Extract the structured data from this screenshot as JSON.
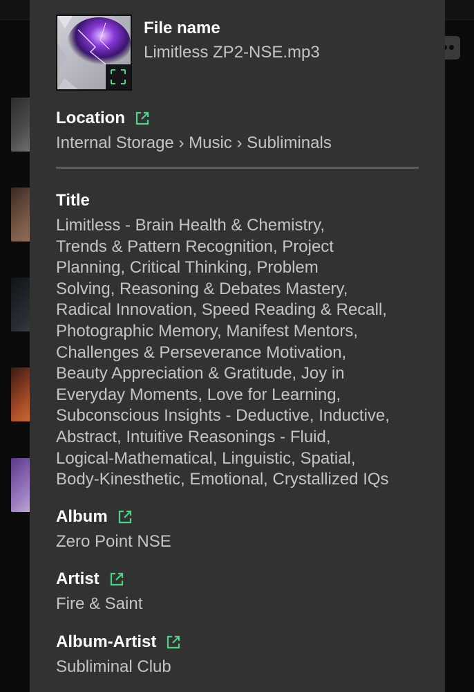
{
  "details": {
    "file_name_label": "File name",
    "file_name": "Limitless ZP2-NSE.mp3",
    "location_label": "Location",
    "location": "Internal Storage › Music › Subliminals",
    "title_label": "Title",
    "title_lines": [
      "Limitless - Brain Health & Chemistry,",
      "Trends & Pattern Recognition, Project",
      "Planning, Critical Thinking, Problem",
      "Solving, Reasoning & Debates Mastery,",
      "Radical Innovation, Speed Reading & Recall,",
      "Photographic Memory, Manifest Mentors,",
      "Challenges & Perseverance Motivation,",
      "Beauty Appreciation & Gratitude, Joy in",
      "Everyday Moments, Love for Learning,",
      "Subconscious Insights - Deductive, Inductive,",
      "Abstract, Intuitive Reasonings - Fluid,",
      "Logical-Mathematical, Linguistic, Spatial,",
      "Body-Kinesthetic, Emotional, Crystallized IQs"
    ],
    "album_label": "Album",
    "album": "Zero Point NSE",
    "artist_label": "Artist",
    "artist": "Fire & Saint",
    "album_artist_label": "Album-Artist",
    "album_artist": "Subliminal Club"
  },
  "icons": {
    "link": "open-in-new-icon",
    "cover": "album-art-thumbnail",
    "more": "more-options-icon"
  },
  "colors": {
    "sheet_background": "#323232",
    "label": "#ffffff",
    "value": "#c4c4c4",
    "accent": "#4ed487",
    "divider": "#5b5b5b"
  }
}
